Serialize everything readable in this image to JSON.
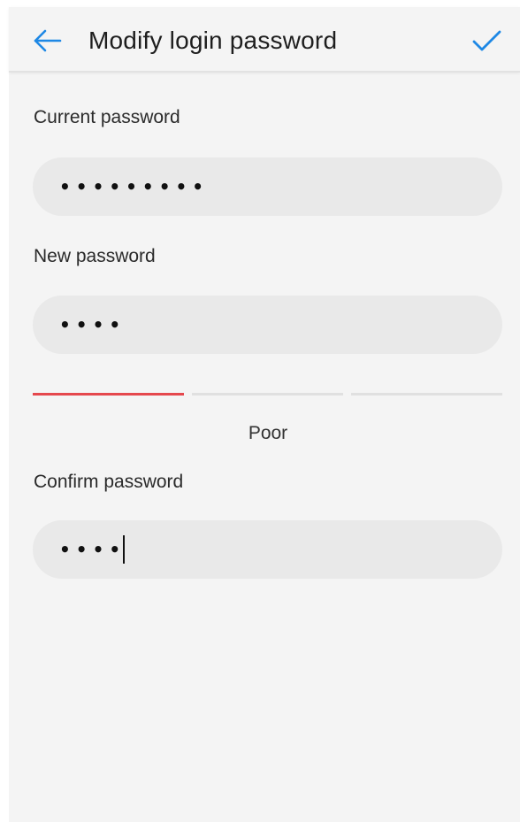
{
  "header": {
    "title": "Modify login password",
    "back_icon": "arrow-left-icon",
    "confirm_icon": "checkmark-icon",
    "accent_color": "#1e88e5"
  },
  "form": {
    "current_password": {
      "label": "Current password",
      "value": "•••••••••"
    },
    "new_password": {
      "label": "New password",
      "value": "••••"
    },
    "strength": {
      "level": 1,
      "levels_total": 3,
      "label": "Poor",
      "active_color": "#e5484d",
      "inactive_color": "#e0e0e0"
    },
    "confirm_password": {
      "label": "Confirm password",
      "value": "••••"
    }
  }
}
